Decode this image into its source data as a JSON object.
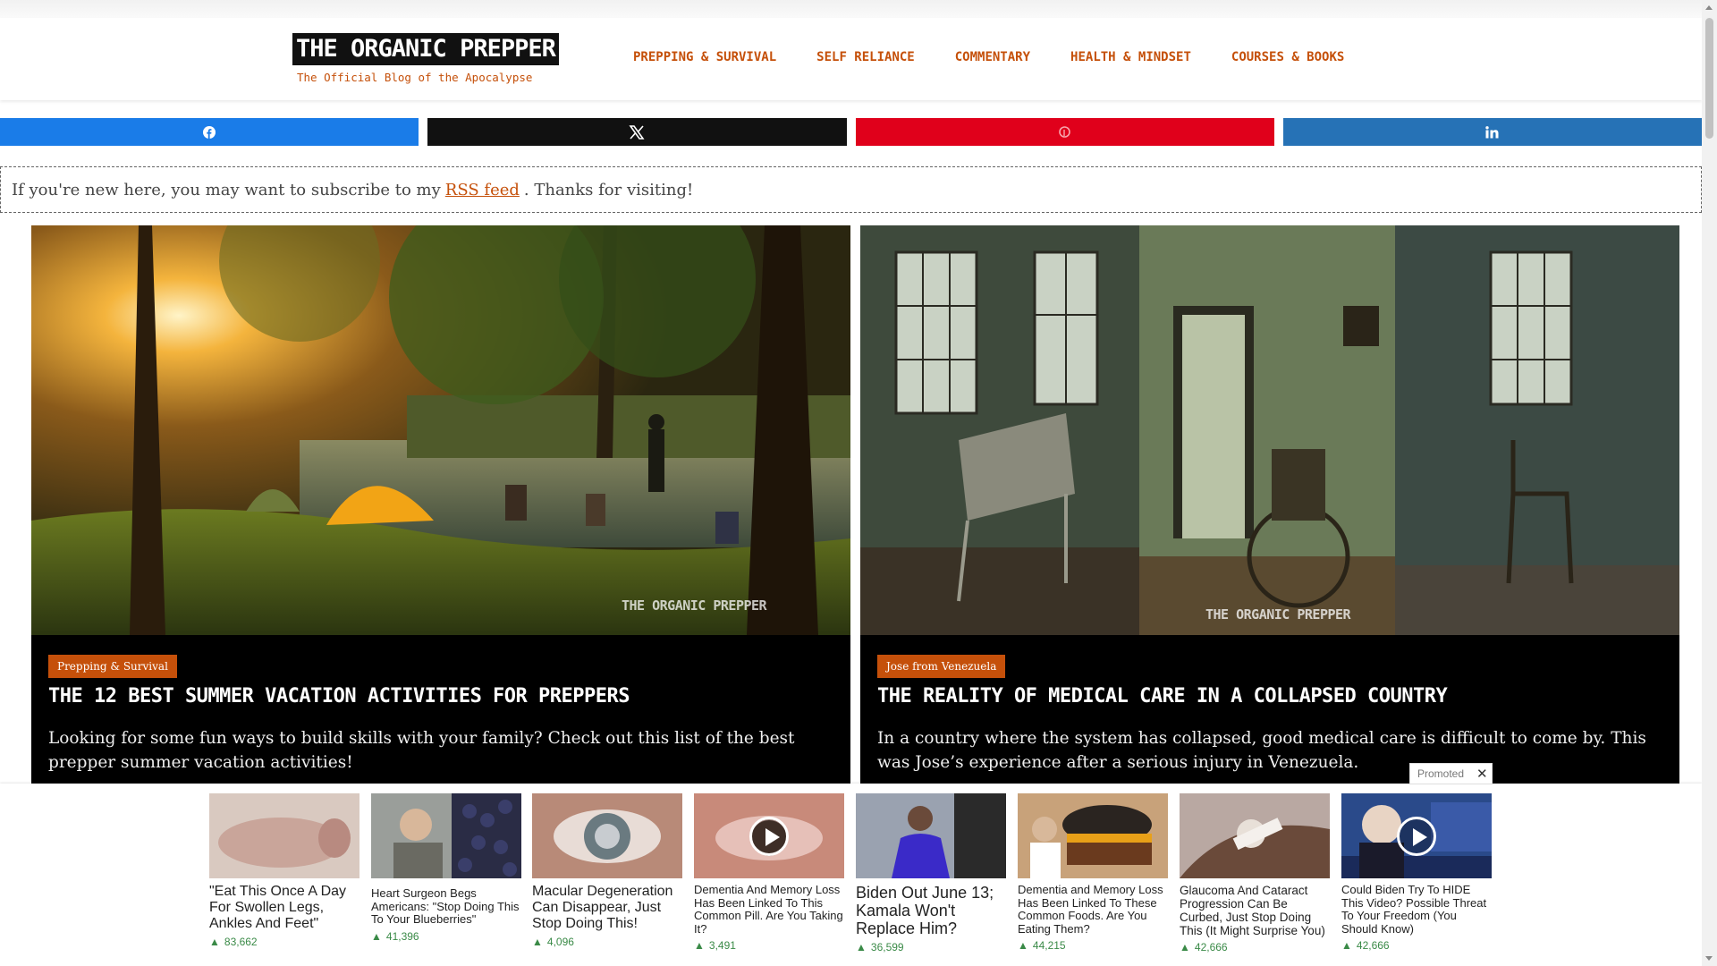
{
  "header": {
    "logo_text": "THE ORGANIC PREPPER",
    "tagline": "The Official Blog of the Apocalypse",
    "nav": [
      "PREPPING & SURVIVAL",
      "SELF RELIANCE",
      "COMMENTARY",
      "HEALTH & MINDSET",
      "COURSES & BOOKS"
    ]
  },
  "share": {
    "icons": [
      "facebook-icon",
      "x-icon",
      "pinterest-icon",
      "linkedin-icon"
    ],
    "colors": {
      "facebook": "#1a7ce8",
      "x": "#111111",
      "pinterest": "#e0001b",
      "linkedin": "#2672b6"
    }
  },
  "notice": {
    "before": "If you're new here, you may want to subscribe to my",
    "link": "RSS feed",
    "after": ". Thanks for visiting!"
  },
  "cards": [
    {
      "category": "Prepping & Survival",
      "title": "THE 12 BEST SUMMER VACATION ACTIVITIES FOR PREPPERS",
      "excerpt": "Looking for some fun ways to build skills with your family? Check out this list of the best prepper summer vacation activities!",
      "watermark": "THE ORGANIC PREPPER"
    },
    {
      "category": "Jose from Venezuela",
      "title": "THE REALITY OF MEDICAL CARE IN A COLLAPSED COUNTRY",
      "excerpt": "In a country where the system has collapsed, good medical care is difficult to come by. This was Jose’s experience after a serious injury in Venezuela.",
      "watermark": "THE ORGANIC PREPPER"
    }
  ],
  "promoted": {
    "label": "Promoted",
    "close": "✕"
  },
  "ads": [
    {
      "headline": "\"Eat This Once A Day For Swollen Legs, Ankles And Feet\"",
      "count": "83,662"
    },
    {
      "headline": "Heart Surgeon Begs Americans: \"Stop Doing This To Your Blueberries\"",
      "count": "41,396"
    },
    {
      "headline": "Macular Degeneration Can Disappear, Just Stop Doing This!",
      "count": "4,096"
    },
    {
      "headline": "Dementia And Memory Loss Has Been Linked To This Common Pill. Are You Taking It?",
      "count": "3,491"
    },
    {
      "headline": "Biden Out June 13; Kamala Won't Replace Him?",
      "count": "36,599"
    },
    {
      "headline": "Dementia and Memory Loss Has Been Linked To These Common Foods. Are You Eating Them?",
      "count": "44,215"
    },
    {
      "headline": "Glaucoma And Cataract Progression Can Be Curbed, Just Stop Doing This (It Might Surprise You)",
      "count": "42,666"
    },
    {
      "headline": "Could Biden Try To HIDE This Video? Possible Threat To Your Freedom (You Should Know)",
      "count": "42,666"
    }
  ]
}
